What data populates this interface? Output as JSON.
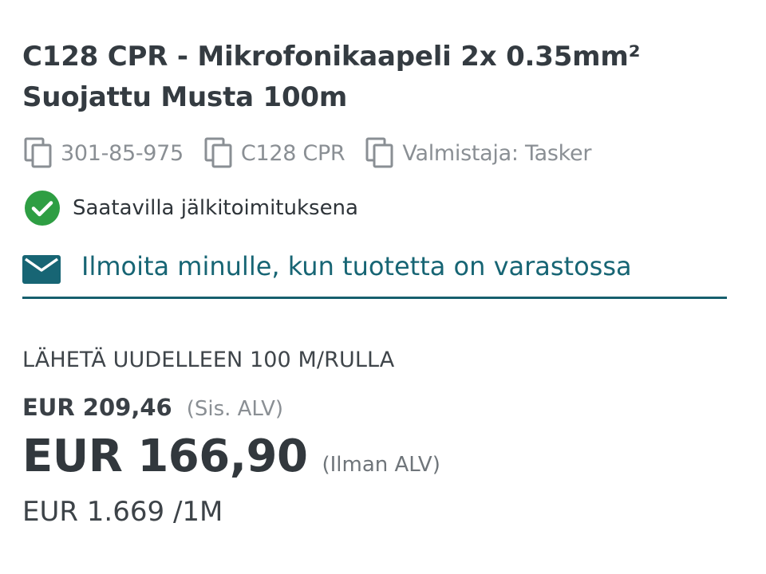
{
  "product": {
    "title": "C128 CPR - Mikrofonikaapeli 2x 0.35mm² Suojattu Musta 100m",
    "meta": [
      {
        "icon": "copy-icon",
        "text": "301-85-975"
      },
      {
        "icon": "copy-icon",
        "text": "C128 CPR"
      },
      {
        "icon": "copy-icon",
        "text": "Valmistaja: Tasker"
      }
    ]
  },
  "availability": {
    "icon": "check-circle-icon",
    "text": "Saatavilla jälkitoimituksena",
    "color": "#2e9e43"
  },
  "notify": {
    "icon": "mail-icon",
    "text": "Ilmoita minulle, kun tuotetta on varastossa",
    "color": "#176574"
  },
  "pricing": {
    "unit_label": "LÄHETÄ UUDELLEEN 100 M/RULLA",
    "gross_price": "EUR 209,46",
    "gross_note": "(Sis. ALV)",
    "net_price": "EUR 166,90",
    "net_note": "(Ilman ALV)",
    "per_meter": "EUR 1.669 /1M"
  }
}
